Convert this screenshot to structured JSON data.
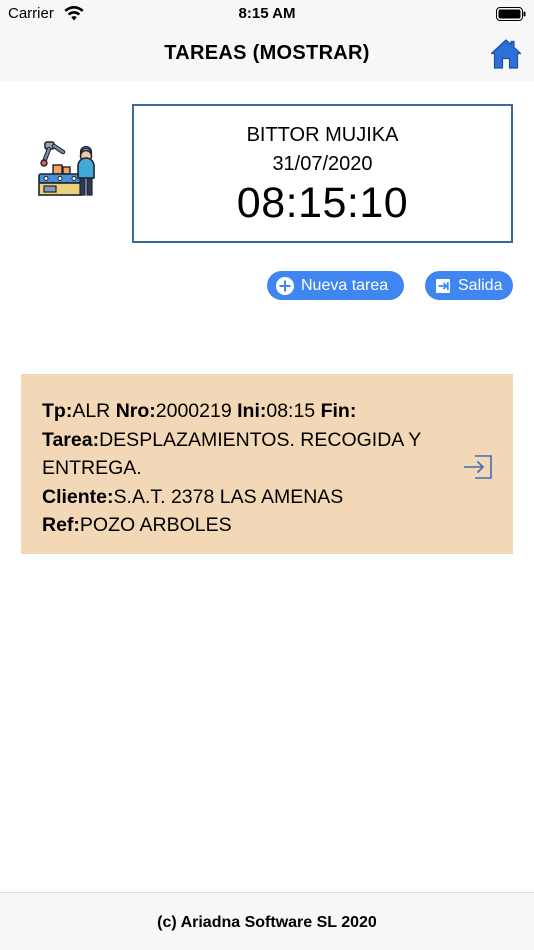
{
  "status_bar": {
    "carrier": "Carrier",
    "time": "8:15 AM",
    "wifi_icon": "wifi-icon",
    "battery_icon": "battery-icon"
  },
  "nav": {
    "title": "TAREAS (MOSTRAR)",
    "home_icon": "home-icon",
    "accent_color": "#2f6fd8"
  },
  "info": {
    "worker_icon": "worker-machine-icon",
    "name": "BITTOR MUJIKA",
    "date": "31/07/2020",
    "clock": "08:15:10",
    "border_color": "#3a6a99"
  },
  "actions": {
    "new_task": {
      "label": "Nueva tarea",
      "icon": "plus-circle-icon"
    },
    "exit": {
      "label": "Salida",
      "icon": "exit-icon"
    },
    "pill_color": "#3f86f0"
  },
  "task": {
    "background": "#f3d8b7",
    "tp_label": "Tp:",
    "tp_value": "ALR",
    "nro_label": "Nro:",
    "nro_value": "2000219",
    "ini_label": "Ini:",
    "ini_value": "08:15",
    "fin_label": "Fin:",
    "fin_value": "",
    "tarea_label": "Tarea:",
    "tarea_value": "DESPLAZAMIENTOS. RECOGIDA Y ENTREGA.",
    "cliente_label": "Cliente:",
    "cliente_value": "S.A.T. 2378 LAS AMENAS",
    "ref_label": "Ref:",
    "ref_value": "POZO ARBOLES",
    "enter_icon": "enter-icon"
  },
  "footer": {
    "text": "(c) Ariadna Software SL 2020"
  }
}
